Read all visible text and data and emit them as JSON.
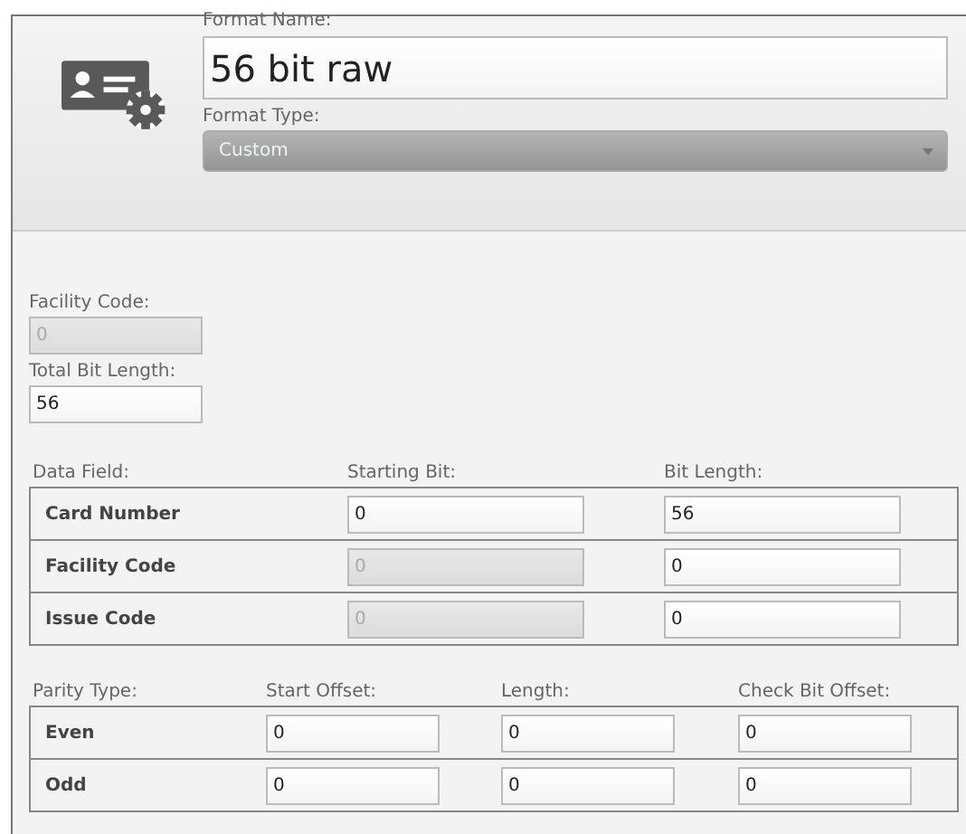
{
  "header": {
    "name_label": "Format Name:",
    "name_value": "56 bit raw",
    "type_label": "Format Type:",
    "type_value": "Custom",
    "type_disabled": true
  },
  "fields": [
    {
      "label": "Facility Code:",
      "value": "0",
      "disabled": true
    },
    {
      "label": "Total Bit Length:",
      "value": "56",
      "disabled": false
    }
  ],
  "data_table": {
    "columns": [
      "Data Field:",
      "Starting Bit:",
      "Bit Length:"
    ],
    "rows": [
      {
        "cells": [
          {
            "kind": "label",
            "value": "Card Number"
          },
          {
            "kind": "input",
            "value": "0",
            "disabled": false
          },
          {
            "kind": "input",
            "value": "56",
            "disabled": false
          }
        ]
      },
      {
        "cells": [
          {
            "kind": "label",
            "value": "Facility Code"
          },
          {
            "kind": "input",
            "value": "0",
            "disabled": true
          },
          {
            "kind": "input",
            "value": "0",
            "disabled": false
          }
        ]
      },
      {
        "cells": [
          {
            "kind": "label",
            "value": "Issue Code"
          },
          {
            "kind": "input",
            "value": "0",
            "disabled": true
          },
          {
            "kind": "input",
            "value": "0",
            "disabled": false
          }
        ]
      }
    ]
  },
  "parity_table": {
    "columns": [
      "Parity Type:",
      "Start Offset:",
      "Length:",
      "Check Bit Offset:"
    ],
    "rows": [
      {
        "cells": [
          {
            "kind": "label",
            "value": "Even"
          },
          {
            "kind": "input",
            "value": "0",
            "disabled": false
          },
          {
            "kind": "input",
            "value": "0",
            "disabled": false
          },
          {
            "kind": "input",
            "value": "0",
            "disabled": false
          }
        ]
      },
      {
        "cells": [
          {
            "kind": "label",
            "value": "Odd"
          },
          {
            "kind": "input",
            "value": "0",
            "disabled": false
          },
          {
            "kind": "input",
            "value": "0",
            "disabled": false
          },
          {
            "kind": "input",
            "value": "0",
            "disabled": false
          }
        ]
      }
    ]
  }
}
